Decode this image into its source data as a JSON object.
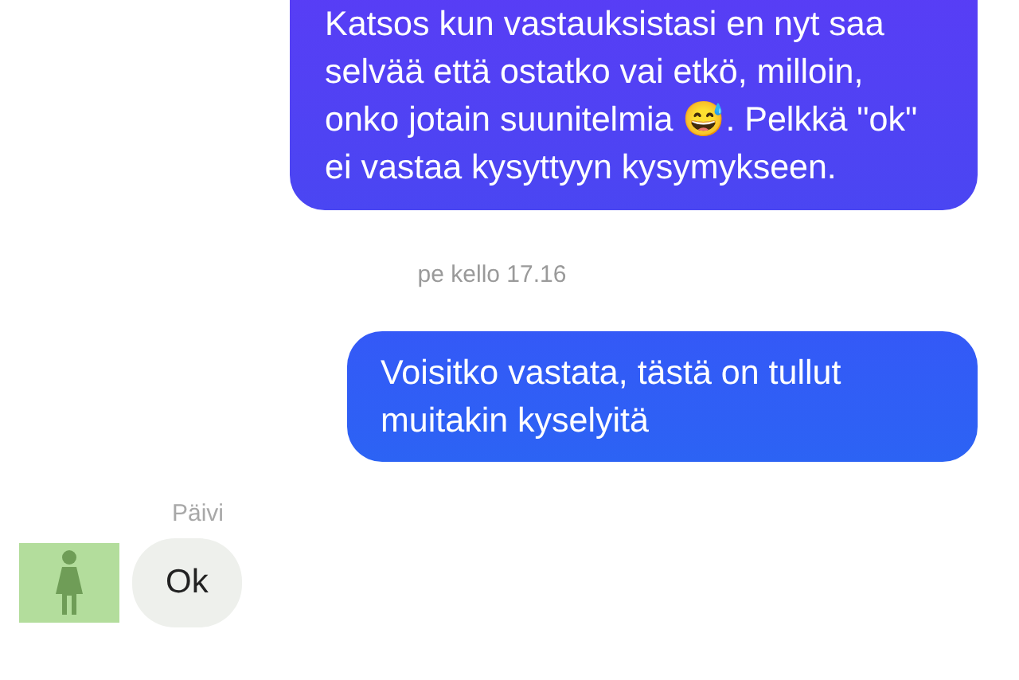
{
  "messages": [
    {
      "kind": "outgoing",
      "text": "Katsos kun vastauksistasi en nyt saa selvää että ostatko vai etkö, milloin, onko jotain suunitelmia 😅. Pelkkä \"ok\" ei vastaa kysyttyyn kysymykseen."
    },
    {
      "kind": "timestamp",
      "text": "pe kello 17.16"
    },
    {
      "kind": "outgoing",
      "text": "Voisitko vastata, tästä on tullut muitakin kyselyitä"
    },
    {
      "kind": "incoming",
      "sender": "Päivi",
      "text": "Ok"
    }
  ]
}
